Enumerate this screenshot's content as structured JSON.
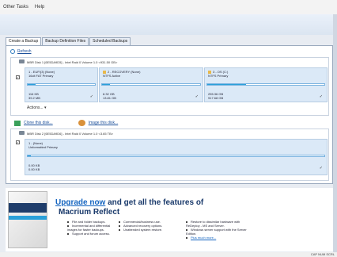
{
  "menu": {
    "item1": "Other Tasks",
    "item2": "Help"
  },
  "tabs": [
    "Create a Backup",
    "Backup Definition Files",
    "Scheduled Backups"
  ],
  "refresh_label": "Refresh",
  "disk1": {
    "title": "MBR Disk 1 [6E5DA9D5] - Intel    Raid 0 Volume 1.0  <931.50 GB>",
    "checked": "✓",
    "partitions": [
      {
        "name": "1 - EUFI(3) (None)",
        "fs": "16cit FAT Primary",
        "fill": 0.12,
        "used": "116 KB",
        "total": "39.2 MB",
        "has_flag": false
      },
      {
        "name": "2 - RECOVERY (None)",
        "fs": "NTFS Active",
        "fill": 0.08,
        "used": "8.32 GB",
        "total": "13.81 GB",
        "has_flag": true
      },
      {
        "name": "3 - OS (C:)",
        "fs": "NTFS Primary",
        "fill": 0.33,
        "used": "255.36 GB",
        "total": "917.68 GB",
        "has_flag": true
      }
    ]
  },
  "actions_label": "Actions...",
  "links": {
    "clone": "Clone this disk...",
    "image": "Image this disk..."
  },
  "disk2": {
    "title": "MBR Disk 2 [6E5DA9D6] - Intel    Raid 0 Volume 1.0  <3.65 TB>",
    "checked": "✓",
    "partition": {
      "name": "1 - (None)",
      "fs": "Unformatted Primary",
      "fill": 0.01,
      "used": "0.00 KB",
      "total": "0.00 KB"
    }
  },
  "ad": {
    "title_link": "Upgrade now",
    "title_rest": " and get all the features of",
    "product": "Macrium Reflect",
    "col1": [
      "File and folder backups.",
      "Incremental and differential images for faster backups.",
      "Support and forum access."
    ],
    "col2": [
      "Commercial/business use.",
      "Advanced recovery options.",
      "Unattended system restore."
    ],
    "col3": [
      "Restore to dissimilar hardware with ReDeploy - MS and Server.",
      "Windows server support with the Server Edition.",
      "Plus much more..."
    ]
  },
  "status": "CAP  NUM  SCRL"
}
